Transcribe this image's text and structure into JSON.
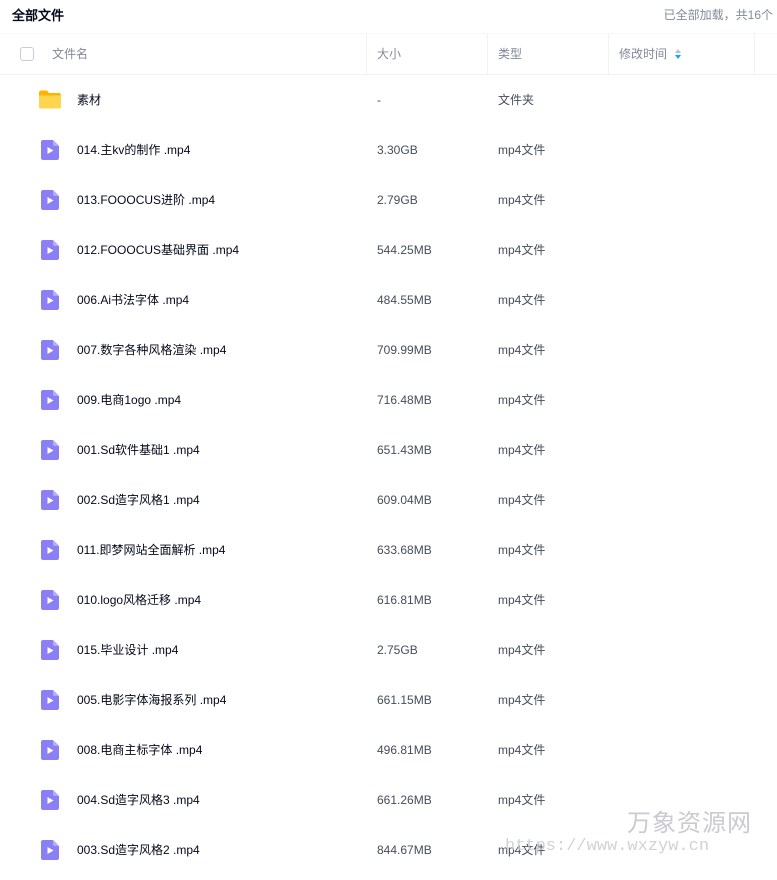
{
  "header": {
    "title": "全部文件",
    "loaded_status": "已全部加载，共16个"
  },
  "columns": {
    "name": "文件名",
    "size": "大小",
    "type": "类型",
    "modified": "修改时间"
  },
  "files": [
    {
      "icon": "folder-icon",
      "name": "素材",
      "size": "-",
      "type": "文件夹"
    },
    {
      "icon": "video-file-icon",
      "name": "014.主kv的制作 .mp4",
      "size": "3.30GB",
      "type": "mp4文件"
    },
    {
      "icon": "video-file-icon",
      "name": "013.FOOOCUS进阶 .mp4",
      "size": "2.79GB",
      "type": "mp4文件"
    },
    {
      "icon": "video-file-icon",
      "name": "012.FOOOCUS基础界面 .mp4",
      "size": "544.25MB",
      "type": "mp4文件"
    },
    {
      "icon": "video-file-icon",
      "name": "006.Ai书法字体 .mp4",
      "size": "484.55MB",
      "type": "mp4文件"
    },
    {
      "icon": "video-file-icon",
      "name": "007.数字各种风格渲染 .mp4",
      "size": "709.99MB",
      "type": "mp4文件"
    },
    {
      "icon": "video-file-icon",
      "name": "009.电商1ogo .mp4",
      "size": "716.48MB",
      "type": "mp4文件"
    },
    {
      "icon": "video-file-icon",
      "name": "001.Sd软件基础1 .mp4",
      "size": "651.43MB",
      "type": "mp4文件"
    },
    {
      "icon": "video-file-icon",
      "name": "002.Sd造字风格1 .mp4",
      "size": "609.04MB",
      "type": "mp4文件"
    },
    {
      "icon": "video-file-icon",
      "name": "011.即梦网站全面解析 .mp4",
      "size": "633.68MB",
      "type": "mp4文件"
    },
    {
      "icon": "video-file-icon",
      "name": "010.logo风格迁移 .mp4",
      "size": "616.81MB",
      "type": "mp4文件"
    },
    {
      "icon": "video-file-icon",
      "name": "015.毕业设计 .mp4",
      "size": "2.75GB",
      "type": "mp4文件"
    },
    {
      "icon": "video-file-icon",
      "name": "005.电影字体海报系列 .mp4",
      "size": "661.15MB",
      "type": "mp4文件"
    },
    {
      "icon": "video-file-icon",
      "name": "008.电商主标字体 .mp4",
      "size": "496.81MB",
      "type": "mp4文件"
    },
    {
      "icon": "video-file-icon",
      "name": "004.Sd造字风格3 .mp4",
      "size": "661.26MB",
      "type": "mp4文件"
    },
    {
      "icon": "video-file-icon",
      "name": "003.Sd造字风格2 .mp4",
      "size": "844.67MB",
      "type": "mp4文件"
    }
  ],
  "watermark": {
    "brand": "万象资源网",
    "url": "https://www.wxzyw.cn"
  },
  "colors": {
    "folder": "#ffca28",
    "video_icon": "#8b7ff5",
    "sort_active": "#06a7ff"
  }
}
